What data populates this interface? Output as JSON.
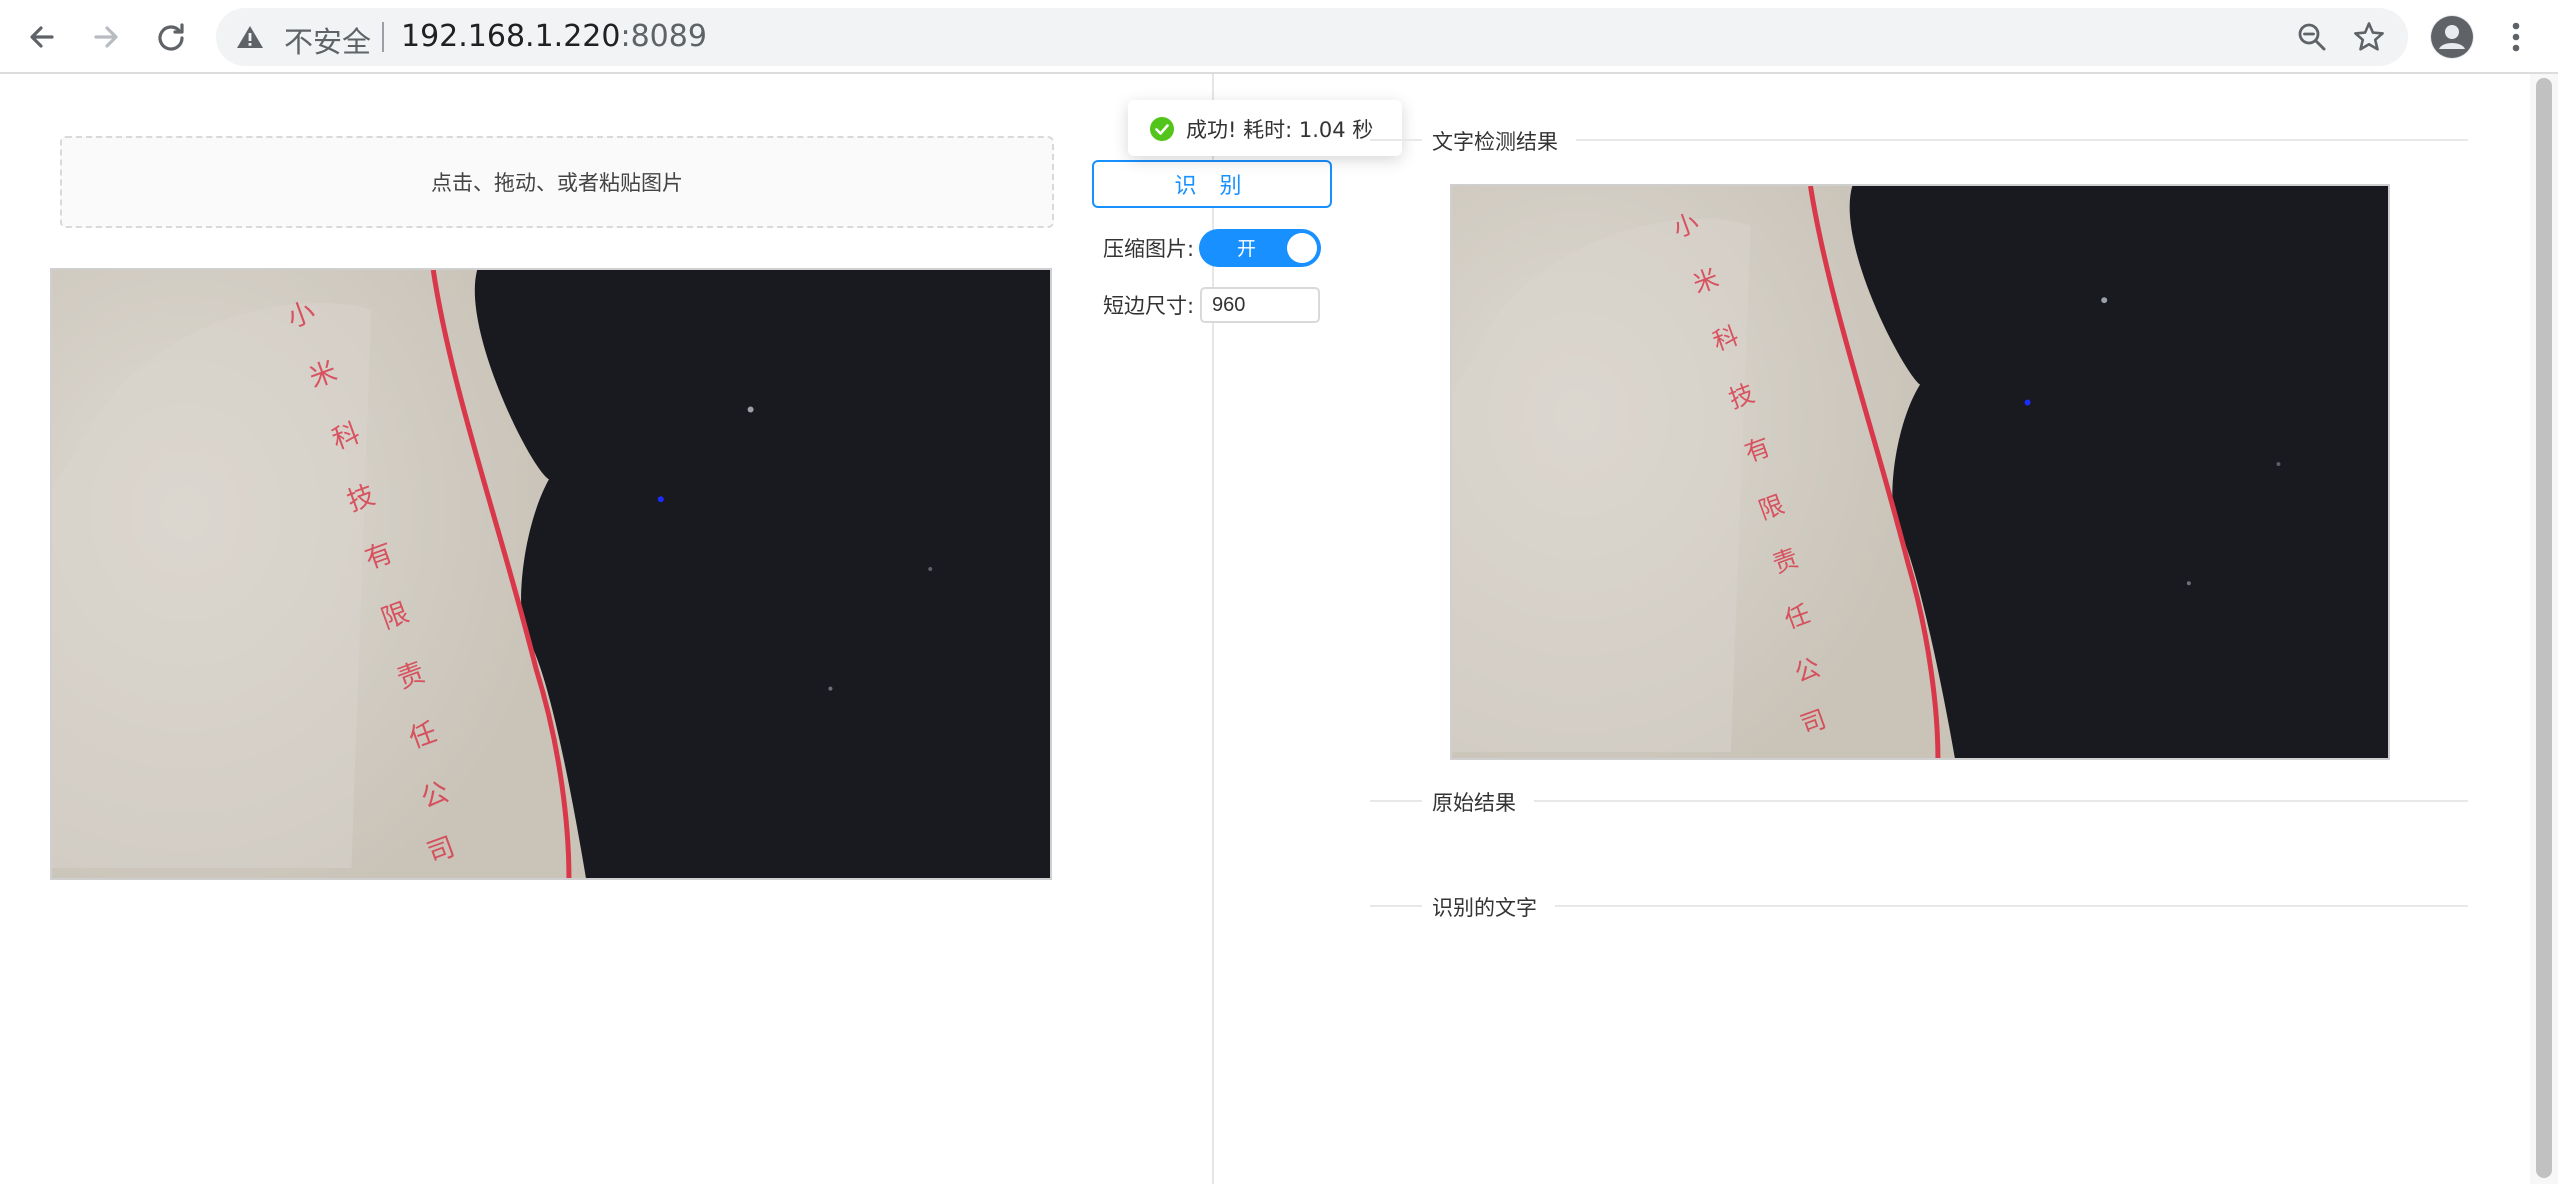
{
  "browser": {
    "security_label": "不安全",
    "url_host": "192.168.1.220",
    "url_port": ":8089"
  },
  "upload": {
    "prompt": "点击、拖动、或者粘贴图片"
  },
  "controls": {
    "recognize_label": "识 别",
    "compress_label": "压缩图片:",
    "compress_toggle_text": "开",
    "compress_on": true,
    "short_side_label": "短边尺寸:",
    "short_side_value": "960"
  },
  "toast": {
    "message": "成功! 耗时: 1.04 秒",
    "type": "success"
  },
  "sections": {
    "detection_title": "文字检测结果",
    "raw_title": "原始结果",
    "text_title": "识别的文字"
  },
  "image": {
    "seal_text": "小米科技有限责任公司",
    "seal_color": "#d8384a"
  },
  "colors": {
    "accent": "#1890ff",
    "success": "#52c41a",
    "divider": "#e8e8e8"
  }
}
